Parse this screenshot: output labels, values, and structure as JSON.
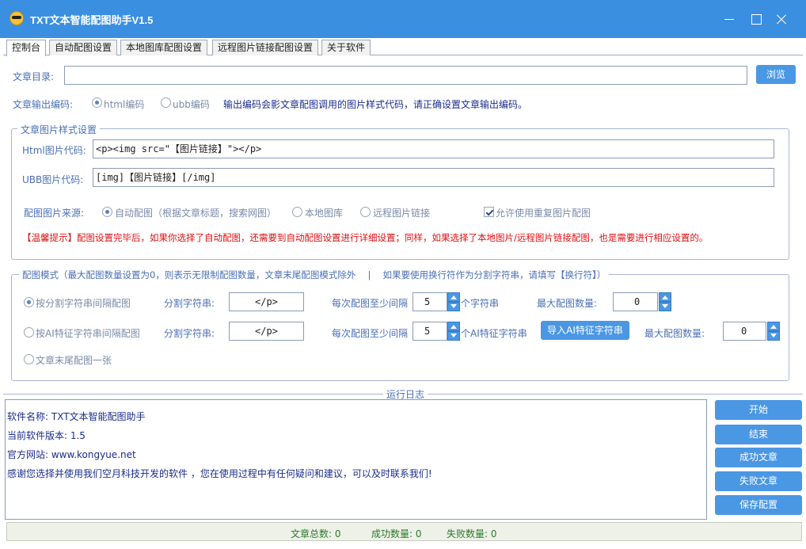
{
  "window": {
    "title": "TXT文本智能配图助手V1.5"
  },
  "tabs": [
    {
      "label": "控制台"
    },
    {
      "label": "自动配图设置"
    },
    {
      "label": "本地图库配图设置"
    },
    {
      "label": "远程图片链接配图设置"
    },
    {
      "label": "关于软件"
    }
  ],
  "article": {
    "dir_label": "文章目录:",
    "dir_value": "",
    "browse_label": "浏览"
  },
  "encoding": {
    "label": "文章输出编码:",
    "html_option": "html编码",
    "ubb_option": "ubb编码",
    "selected": "html",
    "hint": "输出编码会影文章配图调用的图片样式代码，请正确设置文章输出编码。"
  },
  "style_group": {
    "title": "文章图片样式设置",
    "html_label": "Html图片代码:",
    "html_value": "<p><img src=\"【图片链接】\"></p>",
    "ubb_label": "UBB图片代码:",
    "ubb_value": "[img]【图片链接】[/img]",
    "source_label": "配图图片来源:",
    "source_auto": "自动配图（根据文章标题，搜索网图）",
    "source_local": "本地图库",
    "source_remote": "远程图片链接",
    "allow_repeat": "允许使用重复图片配图",
    "allow_repeat_checked": true,
    "tip": "【温馨提示】配图设置完毕后，如果你选择了自动配图，还需要到自动配图设置进行详细设置；同样，如果选择了本地图片/远程图片链接配图，也是需要进行相应设置的。"
  },
  "mode_group": {
    "title": "配图模式（最大配图数量设置为0，则表示无限制配图数量，文章末尾配图模式除外　 |　 如果要使用换行符作为分割字符串，请填写【换行符】）",
    "row1": {
      "mode_label": "按分割字符串间隔配图",
      "split_label": "分割字符串:",
      "split_value": "</p>",
      "interval_label": "每次配图至少间隔",
      "interval_value": "5",
      "interval_unit": "个字符串",
      "max_label": "最大配图数量:",
      "max_value": "0"
    },
    "row2": {
      "mode_label": "按AI特征字符串间隔配图",
      "split_label": "分割字符串:",
      "split_value": "</p>",
      "interval_label": "每次配图至少间隔",
      "interval_value": "5",
      "interval_unit": "个AI特征字符串",
      "import_label": "导入AI特征字符串",
      "max_label": "最大配图数量:",
      "max_value": "0"
    },
    "row3": {
      "mode_label": "文章末尾配图一张"
    }
  },
  "log": {
    "title": "运行日志",
    "lines": [
      "软件名称: TXT文本智能配图助手",
      "当前软件版本: 1.5",
      "官方网站: www.kongyue.net",
      "感谢您选择并使用我们空月科技开发的软件 ，您在使用过程中有任何疑问和建议，可以及时联系我们!"
    ]
  },
  "actions": {
    "start": "开始",
    "stop": "结束",
    "success": "成功文章",
    "fail": "失败文章",
    "save": "保存配置"
  },
  "status": {
    "total_label": "文章总数: 0",
    "success_label": "成功数量: 0",
    "fail_label": "失败数量: 0"
  }
}
